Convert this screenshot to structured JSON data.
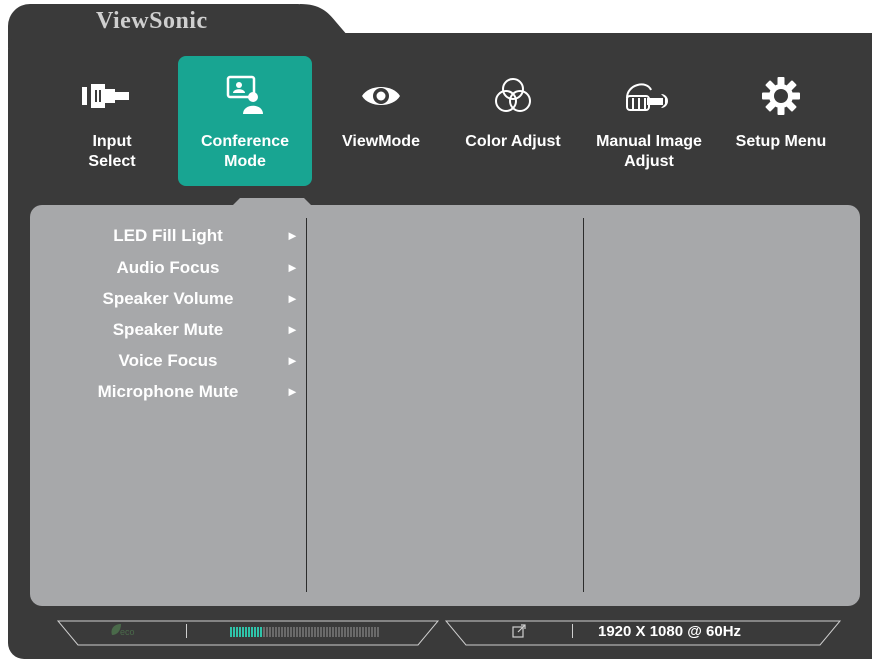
{
  "brand": "ViewSonic",
  "menu": {
    "items": [
      {
        "label": "Input\nSelect",
        "icon": "input-select-icon"
      },
      {
        "label": "Conference\nMode",
        "icon": "conference-mode-icon",
        "active": true
      },
      {
        "label": "ViewMode",
        "icon": "eye-icon"
      },
      {
        "label": "Color Adjust",
        "icon": "color-circles-icon"
      },
      {
        "label": "Manual Image\nAdjust",
        "icon": "hand-wrench-icon"
      },
      {
        "label": "Setup Menu",
        "icon": "gear-icon"
      }
    ]
  },
  "submenu": {
    "items": [
      {
        "label": "LED Fill Light",
        "arrow": "►"
      },
      {
        "label": "Audio Focus",
        "arrow": "►"
      },
      {
        "label": "Speaker Volume",
        "arrow": "►"
      },
      {
        "label": "Speaker Mute",
        "arrow": "►"
      },
      {
        "label": "Voice Focus",
        "arrow": "►"
      },
      {
        "label": "Microphone Mute",
        "arrow": "►"
      }
    ]
  },
  "status": {
    "eco_label": "eco",
    "level_fraction": 0.22,
    "resolution": "1920 X 1080 @ 60Hz"
  },
  "colors": {
    "accent": "#18a592",
    "frame": "#3a3a3a",
    "panel": "#a7a8aa",
    "level_active": "#2fc4aa"
  }
}
